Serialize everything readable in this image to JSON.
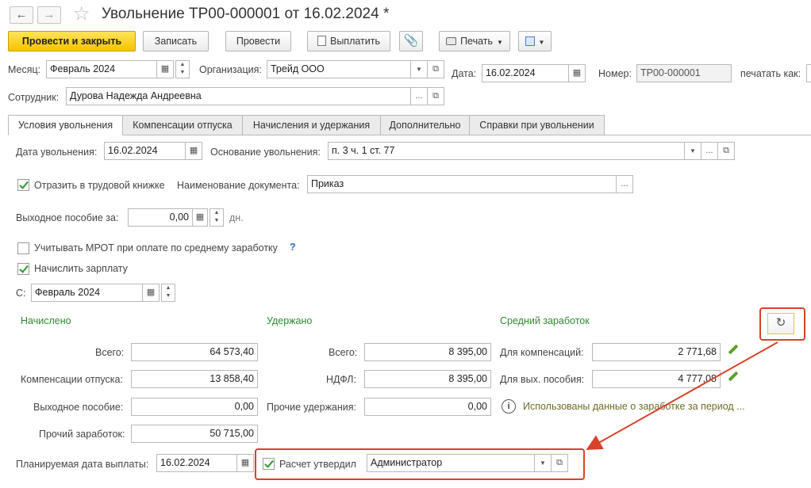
{
  "window": {
    "title": "Увольнение ТР00-000001 от 16.02.2024 *"
  },
  "toolbar": {
    "post_close": "Провести и закрыть",
    "save": "Записать",
    "post": "Провести",
    "pay": "Выплатить",
    "print": "Печать"
  },
  "header": {
    "month_label": "Месяц:",
    "month_value": "Февраль 2024",
    "org_label": "Организация:",
    "org_value": "Трейд ООО",
    "date_label": "Дата:",
    "date_value": "16.02.2024",
    "number_label": "Номер:",
    "number_value": "ТР00-000001",
    "print_as_label": "печатать как:",
    "employee_label": "Сотрудник:",
    "employee_value": "Дурова Надежда Андреевна"
  },
  "tabs": [
    {
      "label": "Условия увольнения"
    },
    {
      "label": "Компенсации отпуска"
    },
    {
      "label": "Начисления и удержания"
    },
    {
      "label": "Дополнительно"
    },
    {
      "label": "Справки при увольнении"
    }
  ],
  "conditions": {
    "dismissal_date_label": "Дата увольнения:",
    "dismissal_date": "16.02.2024",
    "basis_label": "Основание увольнения:",
    "basis_value": "п. 3 ч. 1 ст. 77",
    "reflect_label": "Отразить в трудовой книжке",
    "reflect_checked": true,
    "doc_name_label": "Наименование документа:",
    "doc_name_value": "Приказ",
    "severance_label": "Выходное пособие за:",
    "severance_value": "0,00",
    "severance_unit": "дн.",
    "mrot_label": "Учитывать МРОТ при оплате по среднему заработку",
    "mrot_checked": false,
    "mrot_help": "?",
    "accrue_label": "Начислить зарплату",
    "accrue_checked": true,
    "from_label": "С:",
    "from_value": "Февраль 2024"
  },
  "accrued": {
    "title": "Начислено",
    "total_label": "Всего:",
    "total": "64 573,40",
    "vacation_label": "Компенсации отпуска:",
    "vacation": "13 858,40",
    "severance_label": "Выходное пособие:",
    "severance": "0,00",
    "other_label": "Прочий заработок:",
    "other": "50 715,00"
  },
  "withheld": {
    "title": "Удержано",
    "total_label": "Всего:",
    "total": "8 395,00",
    "ndfl_label": "НДФЛ:",
    "ndfl": "8 395,00",
    "other_label": "Прочие удержания:",
    "other": "0,00"
  },
  "average": {
    "title": "Средний заработок",
    "comp_label": "Для компенсаций:",
    "comp": "2 771,68",
    "sev_label": "Для вых. пособия:",
    "sev": "4 777,08",
    "info_text": "Использованы данные о заработке за период ..."
  },
  "footer": {
    "plan_date_label": "Планируемая дата выплаты:",
    "plan_date": "16.02.2024",
    "approved_label": "Расчет утвердил",
    "approved_checked": true,
    "approved_by": "Администратор"
  },
  "colors": {
    "accent_yellow": "#f4c400",
    "highlight_red": "#d9412b",
    "section_green": "#2e8b2e"
  }
}
